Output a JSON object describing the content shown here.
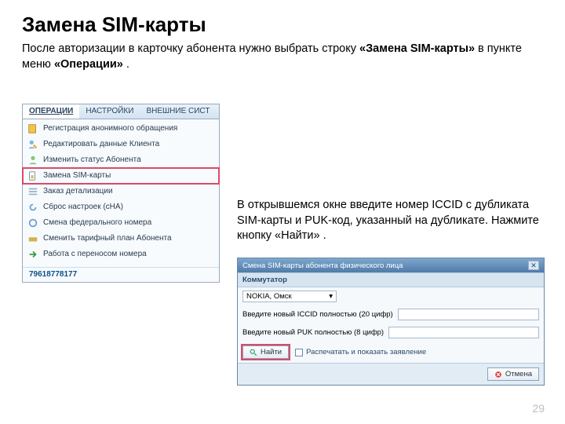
{
  "title": "Замена SIM-карты",
  "intro_parts": {
    "p1": "После авторизации в карточку абонента нужно выбрать строку ",
    "b1": "«Замена SIM-карты»",
    "p2": " в пункте меню ",
    "b2": "«Операции»",
    "p3": " ."
  },
  "menu": {
    "tabs": {
      "active": "ОПЕРАЦИИ",
      "t2": "НАСТРОЙКИ",
      "t3": "ВНЕШНИЕ СИСТ"
    },
    "items": [
      "Регистрация анонимного обращения",
      "Редактировать данные Клиента",
      "Изменить статус Абонента",
      "Замена SIM-карты",
      "Заказ детализации",
      "Сброс настроек (сНА)",
      "Смена федерального номера",
      "Сменить тарифный план Абонента",
      "Работа с переносом номера"
    ],
    "phone": "79618778177"
  },
  "para2": "В открывшемся окне введите номер ICCID с дубликата SIM-карты и PUK-код, указанный на дубликате. Нажмите кнопку «Найти» .",
  "dialog": {
    "title": "Смена SIM-карты абонента физического лица",
    "section": "Коммутатор",
    "combo_value": "NOKIA, Омск",
    "iccid_label": "Введите новый ICCID полностью (20 цифр)",
    "puk_label": "Введите новый PUK полностью (8 цифр)",
    "find_btn": "Найти",
    "checkbox": "Распечатать и показать заявление",
    "cancel": "Отмена"
  },
  "pagenum": "29"
}
